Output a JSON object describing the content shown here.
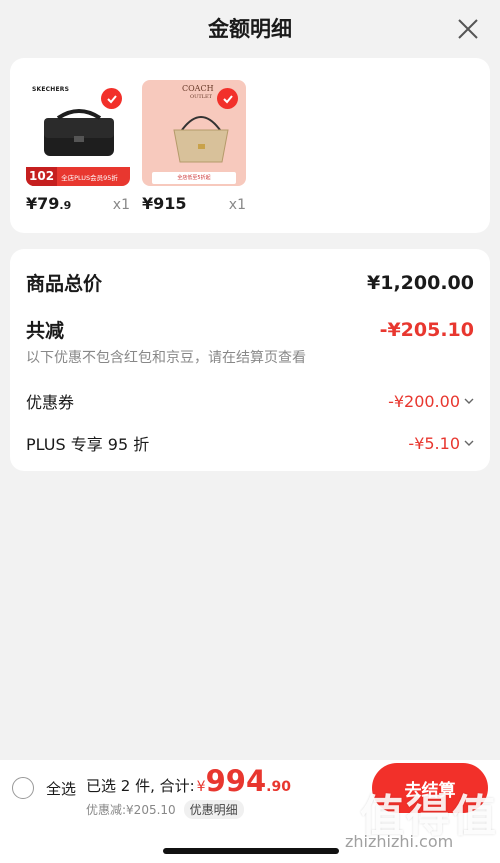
{
  "header": {
    "title": "金额明细"
  },
  "products": [
    {
      "brand": "SKECHERS",
      "badge_num": "102",
      "badge_text": "全店PLUS会员95折",
      "price_main": "¥79",
      "price_dec": ".9",
      "qty": "x1"
    },
    {
      "brand": "COACH",
      "brand_sub": "OUTLET",
      "badge_text": "全店低至5折起",
      "price_main": "¥915",
      "price_dec": "",
      "qty": "x1"
    }
  ],
  "details": {
    "total_label": "商品总价",
    "total_value": "¥1,200.00",
    "reduce_label": "共减",
    "reduce_value": "-¥205.10",
    "note": "以下优惠不包含红包和京豆，请在结算页查看",
    "items": [
      {
        "label": "优惠券",
        "value": "-¥200.00"
      },
      {
        "label": "PLUS 专享 95 折",
        "value": "-¥5.10"
      }
    ]
  },
  "bottom": {
    "select_all": "全选",
    "selected_text": "已选 2 件, 合计:",
    "currency": "¥",
    "total_int": "994",
    "total_dec": ".90",
    "discount_text": "优惠减:¥205.10",
    "detail_btn": "优惠明细",
    "checkout": "去结算"
  },
  "watermark": {
    "text": "值得值",
    "url": "zhizhizhi.com"
  },
  "colors": {
    "accent": "#f2302a",
    "text": "#1a1a1a",
    "muted": "#888888"
  }
}
